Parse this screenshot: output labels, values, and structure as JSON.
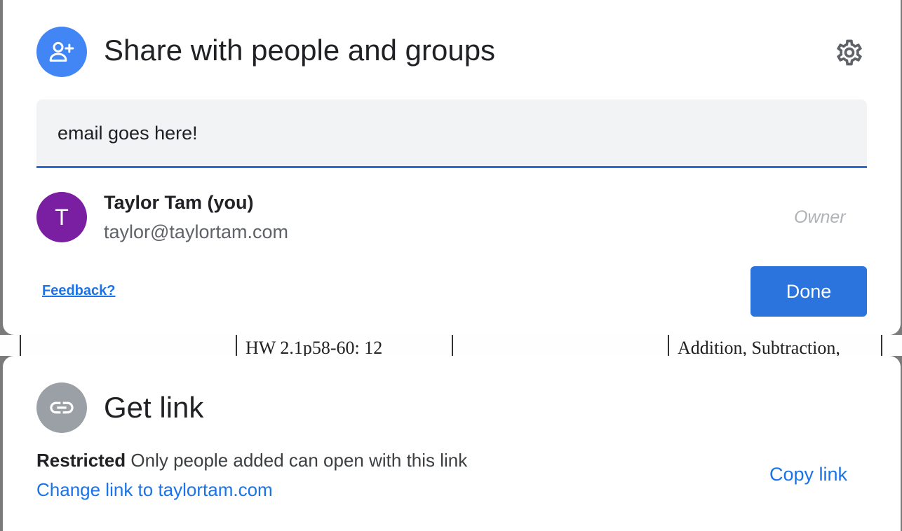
{
  "background_document": {
    "cell_text_1": "HW 2.1p58-60: 12",
    "cell_text_2": "Addition, Subtraction,"
  },
  "share_dialog": {
    "title": "Share with people and groups",
    "header_icon": "person-add-icon",
    "settings_icon": "gear-icon",
    "email_input": {
      "value": "email goes here!"
    },
    "people": [
      {
        "avatar_letter": "T",
        "avatar_color": "#7b1fa2",
        "name": "Taylor Tam (you)",
        "email": "taylor@taylortam.com",
        "role": "Owner"
      }
    ],
    "feedback_label": "Feedback?",
    "done_label": "Done"
  },
  "link_dialog": {
    "title": "Get link",
    "header_icon": "link-icon",
    "access_level": "Restricted",
    "access_description": "Only people added can open with this link",
    "change_link_label": "Change link to taylortam.com",
    "copy_link_label": "Copy link"
  },
  "colors": {
    "accent_blue": "#1a73e8",
    "done_button": "#2b74de",
    "share_icon_bg": "#4285f4",
    "link_icon_bg": "#9aa0a6",
    "input_underline": "#2a6ed4"
  }
}
